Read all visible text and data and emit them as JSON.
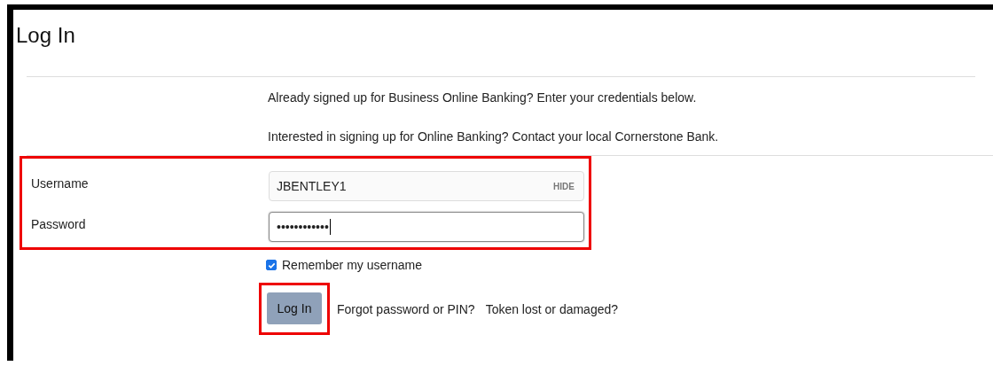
{
  "title": "Log In",
  "intro": [
    "Already signed up for Business Online Banking? Enter your credentials below.",
    "Interested in signing up for Online Banking? Contact your local Cornerstone Bank."
  ],
  "fields": [
    {
      "label": "Username",
      "value": "JBENTLEY1",
      "action": "HIDE",
      "focused": false
    },
    {
      "label": "Password",
      "value": "••••••••••••",
      "focused": true
    }
  ],
  "remember": {
    "label": "Remember my username",
    "checked": true
  },
  "login_button": "Log In",
  "links": [
    "Forgot password or PIN?",
    "Token lost or damaged?"
  ]
}
